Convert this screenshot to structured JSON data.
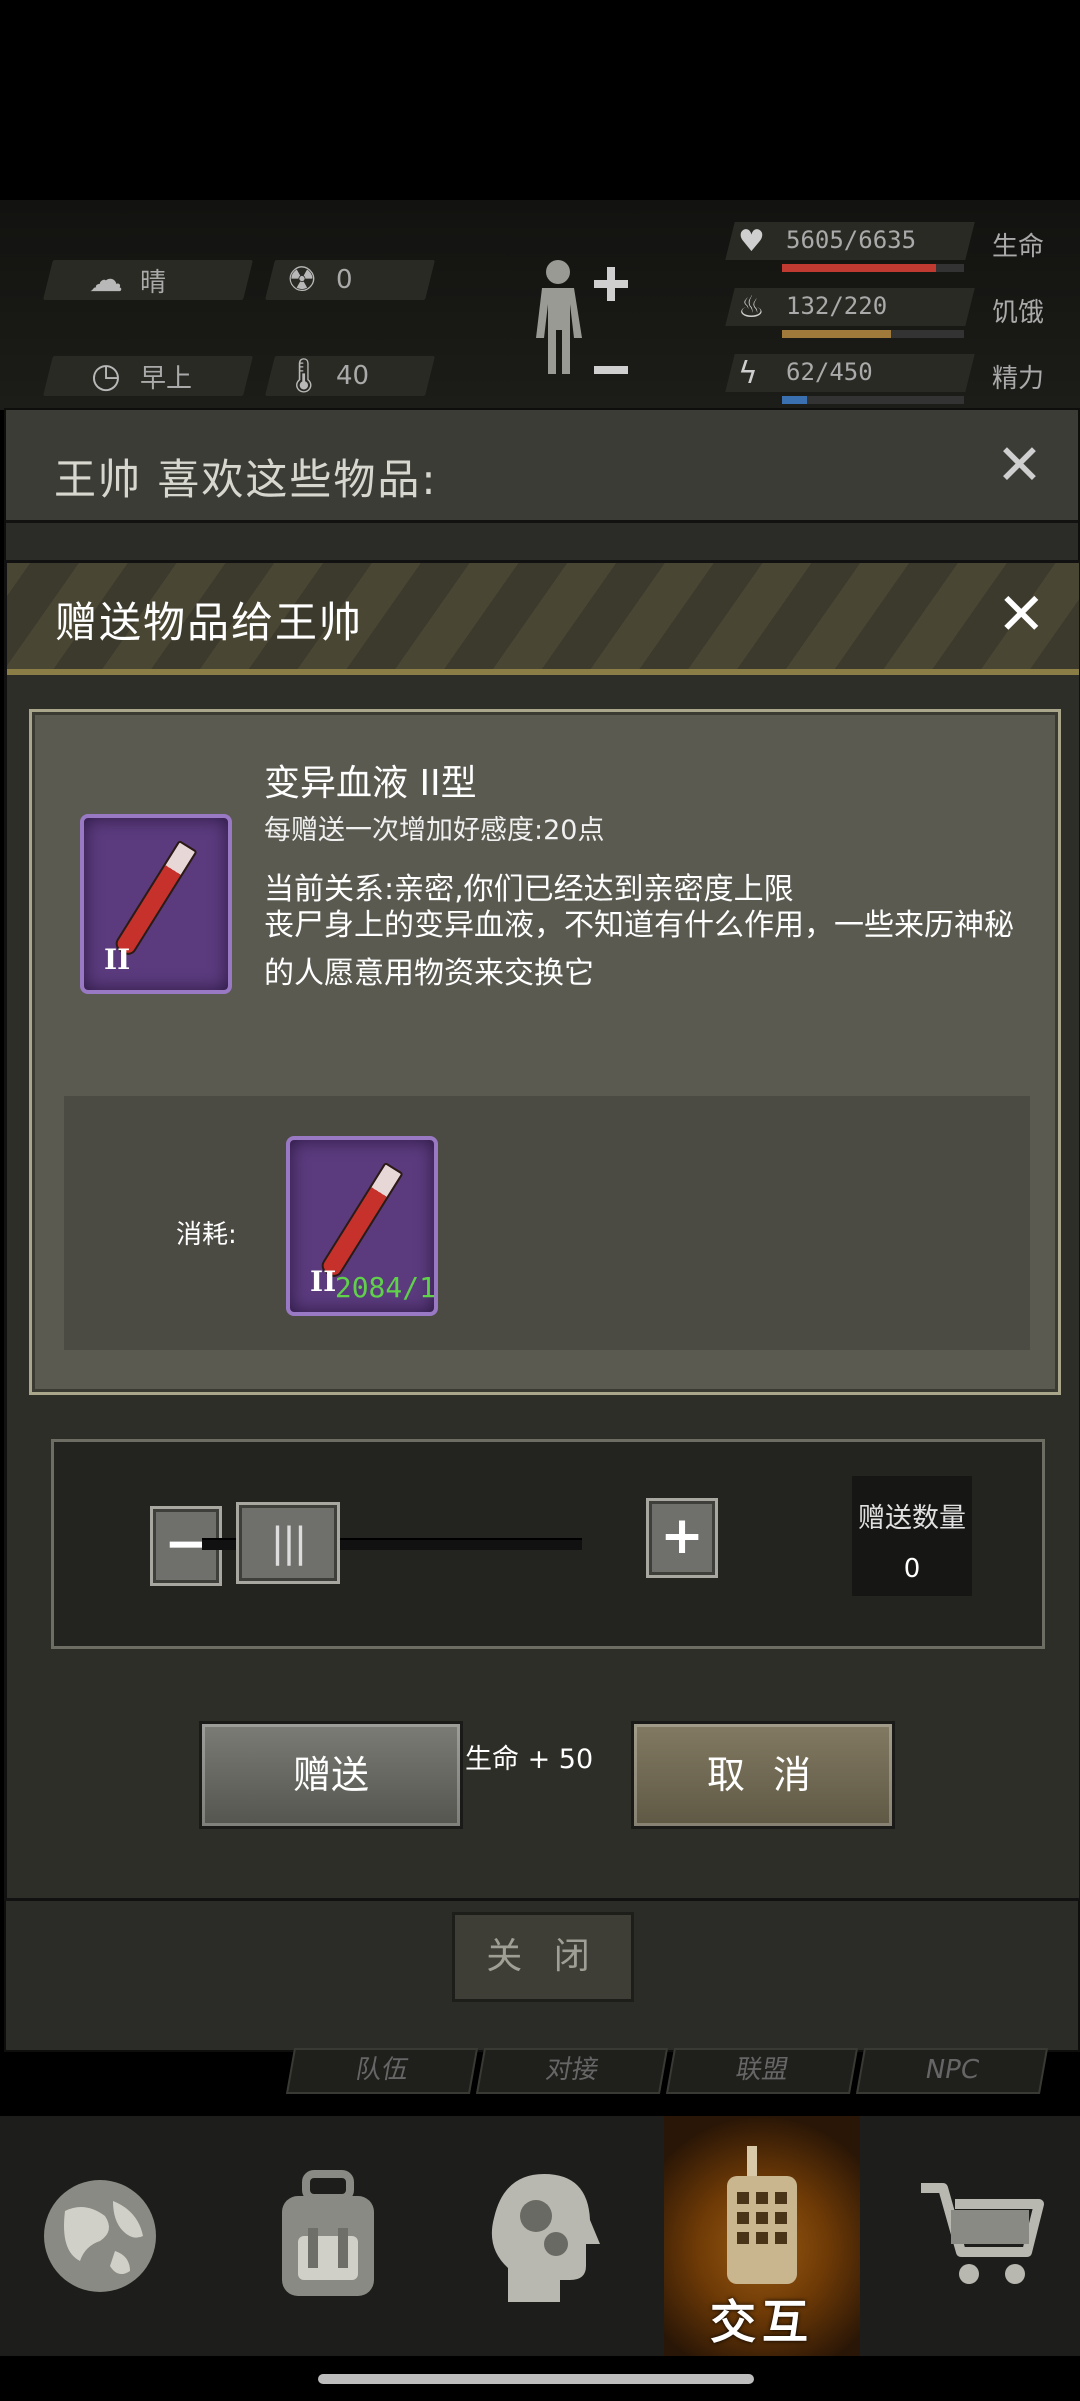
{
  "status": {
    "weather": {
      "icon": "partly-cloudy-icon",
      "text": "晴"
    },
    "radiation": {
      "icon": "radiation-icon",
      "text": "0"
    },
    "time": {
      "icon": "clock-icon",
      "text": "早上"
    },
    "temperature": {
      "icon": "thermometer-icon",
      "text": "40"
    },
    "bars": [
      {
        "name": "health",
        "icon": "heart-pulse-icon",
        "value": "5605/6635",
        "label": "生命",
        "fraction": 0.845,
        "color": "#c03a32"
      },
      {
        "name": "hunger",
        "icon": "stomach-icon",
        "value": "132/220",
        "label": "饥饿",
        "fraction": 0.6,
        "color": "#a07a3a"
      },
      {
        "name": "energy",
        "icon": "energy-icon",
        "value": "62/450",
        "label": "精力",
        "fraction": 0.138,
        "color": "#3a6fb0"
      }
    ]
  },
  "likes_panel": {
    "title": "王帅 喜欢这些物品:"
  },
  "gift_dialog": {
    "title": "赠送物品给王帅",
    "item": {
      "name": "变异血液 II型",
      "affinity": "每赠送一次增加好感度:20点",
      "relation": "当前关系:亲密,你们已经达到亲密度上限",
      "description": "丧尸身上的变异血液，不知道有什么作用，一些来历神秘的人愿意用物资来交换它",
      "tier": "II",
      "tile_color": "#5b3b7e"
    },
    "consume": {
      "label": "消耗:",
      "count": "2084/1",
      "tier": "II"
    },
    "quantity": {
      "label": "赠送数量",
      "value": "0",
      "slider_fraction": 0.0
    },
    "gift_button": "赠送",
    "effect": "生命 + 50",
    "cancel_button": "取 消"
  },
  "close_button": "关 闭",
  "tabs": [
    "队伍",
    "对接",
    "联盟",
    "NPC"
  ],
  "bottom_nav": [
    {
      "name": "world",
      "icon": "globe-icon",
      "label": ""
    },
    {
      "name": "backpack",
      "icon": "backpack-icon",
      "label": ""
    },
    {
      "name": "skills",
      "icon": "head-gears-icon",
      "label": ""
    },
    {
      "name": "interact",
      "icon": "walkie-talkie-icon",
      "label": "交互",
      "active": true
    },
    {
      "name": "shop",
      "icon": "shopping-cart-icon",
      "label": ""
    }
  ]
}
